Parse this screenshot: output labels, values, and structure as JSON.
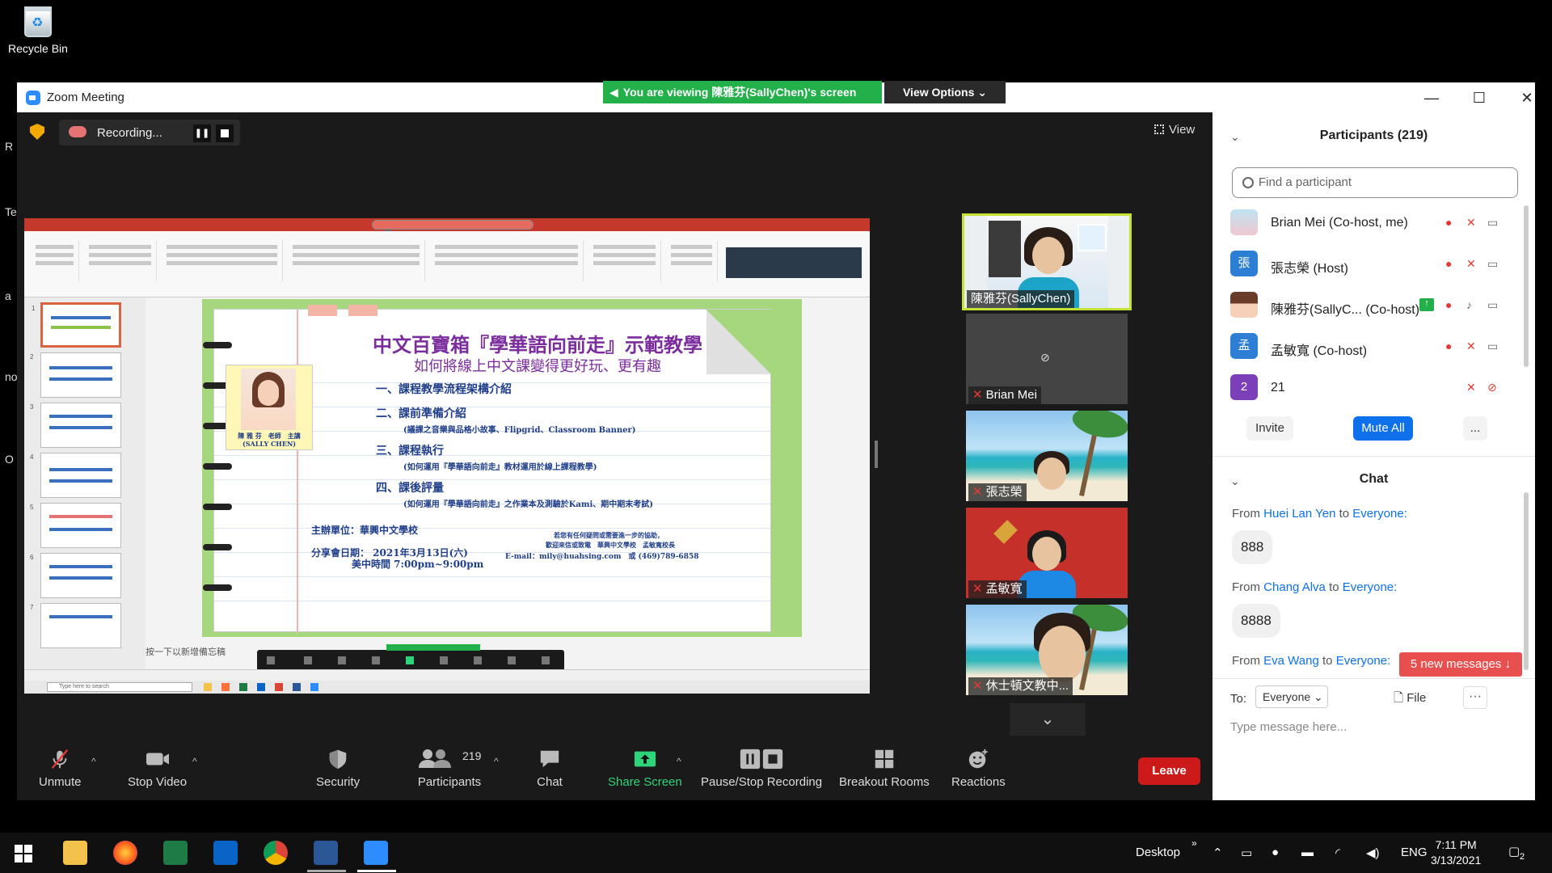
{
  "desktop": {
    "recycle_bin": "Recycle Bin",
    "fragments": [
      "R",
      "Te",
      "a",
      "no",
      "O"
    ]
  },
  "window": {
    "title": "Zoom Meeting",
    "viewing_banner": "You  are  viewing 陳雅芬(SallyChen)'s  screen",
    "view_options": "View Options",
    "minimize": "—",
    "maximize": "☐",
    "close": "✕"
  },
  "meeting": {
    "recording_label": "Recording...",
    "view_label": "View"
  },
  "slide": {
    "title": "中文百寶箱『學華語向前走』示範教學",
    "subtitle": "如何將線上中文課變得更好玩、更有趣",
    "items": [
      "一、課程教學流程架構介紹",
      "二、課前準備介紹",
      "(議課之音樂與品格小故事、Flipgrid、Classroom Banner)",
      "三、課程執行",
      "(如何運用『學華語向前走』教材運用於線上課程教學)",
      "四、課後評量",
      "(如何運用『學華語向前走』之作業本及測驗於Kami、期中期末考試)"
    ],
    "host": "主辦單位：華興中文學校",
    "date_line": "分享會日期： 2021年3月13日(六)",
    "time_line": "美中時間 7:00pm~9:00pm",
    "contact_1": "若您有任何疑問或需要進一步的協助，",
    "contact_2": "歡迎來信或致電　華興中文學校　孟敏寬校長",
    "contact_3": "E-mail：mily@huahsing.com　或 (469)789-6858",
    "speaker_1": "陳 雅 芬　老師　主講",
    "speaker_2": "(SALLY CHEN)",
    "notes_hint": "按一下以新增備忘稿",
    "search_hint": "Type here to search"
  },
  "video_tiles": [
    {
      "name": "陳雅芬(SallyChen)"
    },
    {
      "name": "Brian Mei"
    },
    {
      "name": "張志榮"
    },
    {
      "name": "孟敏寬"
    },
    {
      "name": "休士頓文教中..."
    }
  ],
  "toolbar": {
    "unmute": "Unmute",
    "stop_video": "Stop Video",
    "security": "Security",
    "participants": "Participants",
    "participants_count": "219",
    "chat": "Chat",
    "share_screen": "Share Screen",
    "recording": "Pause/Stop Recording",
    "breakout": "Breakout Rooms",
    "reactions": "Reactions",
    "leave": "Leave"
  },
  "participants_panel": {
    "title": "Participants (219)",
    "search_placeholder": "Find a participant",
    "rows": [
      {
        "name": "Brian Mei (Co-host, me)",
        "avatar": "",
        "avatar_color": "#9ec5d8"
      },
      {
        "name": "張志榮 (Host)",
        "avatar": "張",
        "avatar_color": "#2d7fd6"
      },
      {
        "name": "陳雅芬(SallyC...  (Co-host)",
        "avatar": "",
        "avatar_color": "#f2d6c9"
      },
      {
        "name": "孟敏寬 (Co-host)",
        "avatar": "孟",
        "avatar_color": "#2d7fd6"
      },
      {
        "name": "21",
        "avatar": "2",
        "avatar_color": "#7b3fb8"
      }
    ],
    "invite": "Invite",
    "mute_all": "Mute All",
    "more": "..."
  },
  "chat_panel": {
    "title": "Chat",
    "messages": [
      {
        "from_label": "From",
        "sender": "Huei Lan Yen",
        "to_label": "to",
        "recipient": "Everyone:",
        "text": "888"
      },
      {
        "from_label": "From",
        "sender": "Chang Alva",
        "to_label": "to",
        "recipient": "Everyone:",
        "text": "8888"
      },
      {
        "from_label": "From",
        "sender": "Eva Wang",
        "to_label": "to",
        "recipient": "Everyone:",
        "text": ""
      }
    ],
    "new_messages": "5 new messages ↓",
    "to_label": "To:",
    "to_value": "Everyone",
    "file": "File",
    "more": "···",
    "placeholder": "Type message here..."
  },
  "taskbar": {
    "desktop_label": "Desktop",
    "language": "ENG",
    "time": "7:11 PM",
    "date": "3/13/2021",
    "notifications": "2"
  },
  "colors": {
    "zoom_blue": "#0e71eb",
    "share_green": "#2ed47a",
    "leave_red": "#cc1a1a",
    "banner_green": "#23b04a"
  }
}
